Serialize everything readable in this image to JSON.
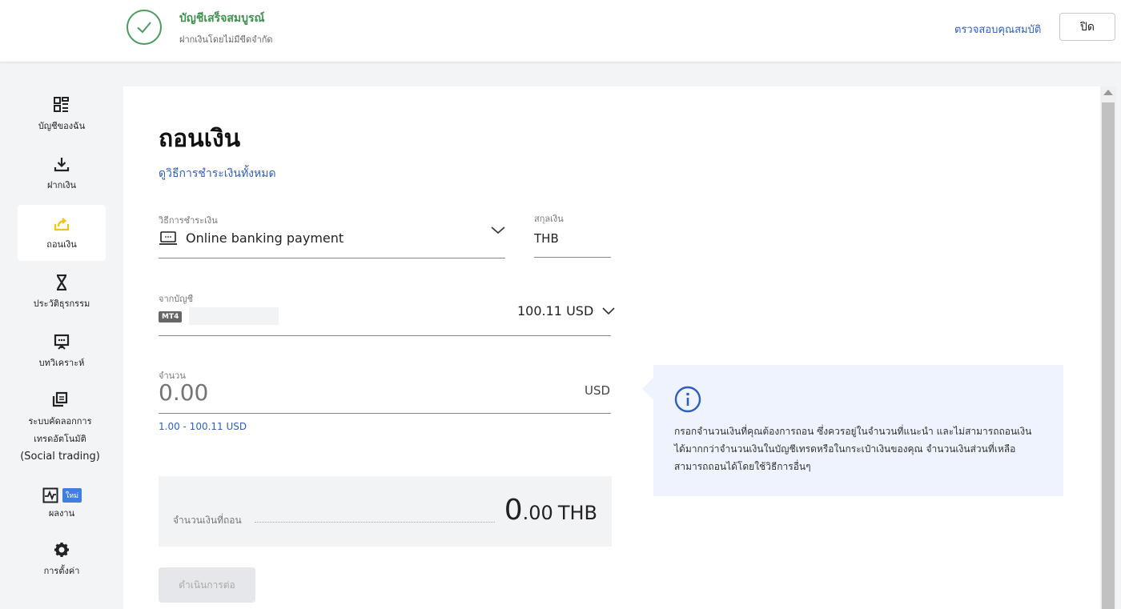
{
  "banner": {
    "title": "บัญชีเสร็จสมบูรณ์",
    "subtitle": "ฝากเงินโดยไม่มีขีดจำกัด",
    "verify_link": "ตรวจสอบคุณสมบัติ",
    "close_label": "ปิด"
  },
  "sidebar": {
    "items": [
      {
        "label": "บัญชีของฉัน",
        "icon": "grid-icon"
      },
      {
        "label": "ฝากเงิน",
        "icon": "download-icon"
      },
      {
        "label": "ถอนเงิน",
        "icon": "withdraw-icon",
        "active": true
      },
      {
        "label": "ประวัติธุรกรรม",
        "icon": "hourglass-icon"
      },
      {
        "label": "บทวิเคราะห์",
        "icon": "presentation-icon"
      },
      {
        "label_line1": "ระบบคัดลอกการ",
        "label_line2": "เทรดอัตโนมัติ",
        "label_line3": "(Social trading)",
        "icon": "copy-icon"
      },
      {
        "label": "ผลงาน",
        "icon": "chart-icon",
        "badge": "ใหม่"
      },
      {
        "label": "การตั้งค่า",
        "icon": "gear-icon"
      }
    ]
  },
  "main": {
    "title": "ถอนเงิน",
    "all_methods_link": "ดูวิธีการชำระเงินทั้งหมด",
    "payment_method": {
      "label": "วิธีการชำระเงิน",
      "value": "Online banking payment"
    },
    "currency": {
      "label": "สกุลเงิน",
      "value": "THB"
    },
    "from_account": {
      "label": "จากบัญชี",
      "tag": "MT4",
      "balance": "100.11 USD"
    },
    "amount": {
      "label": "จำนวน",
      "placeholder": "0.00",
      "currency": "USD",
      "range": "1.00 - 100.11 USD"
    },
    "summary": {
      "label": "จำนวนเงินที่ถอน",
      "amount_int": "0",
      "amount_dec": ".00",
      "currency": "THB"
    },
    "continue_label": "ดำเนินการต่อ",
    "info_text": "กรอกจำนวนเงินที่คุณต้องการถอน ซึ่งควรอยู่ในจำนวนที่แนะนำ และไม่สามารถถอนเงินได้มากกว่าจำนวนเงินในบัญชีเทรดหรือในกระเป๋าเงินของคุณ จำนวนเงินส่วนที่เหลือสามารถถอนได้โดยใช้วิธีการอื่นๆ"
  },
  "colors": {
    "accent": "#2f5fbd",
    "success": "#3f8f4f",
    "active_nav_icon": "#f2c21b"
  }
}
